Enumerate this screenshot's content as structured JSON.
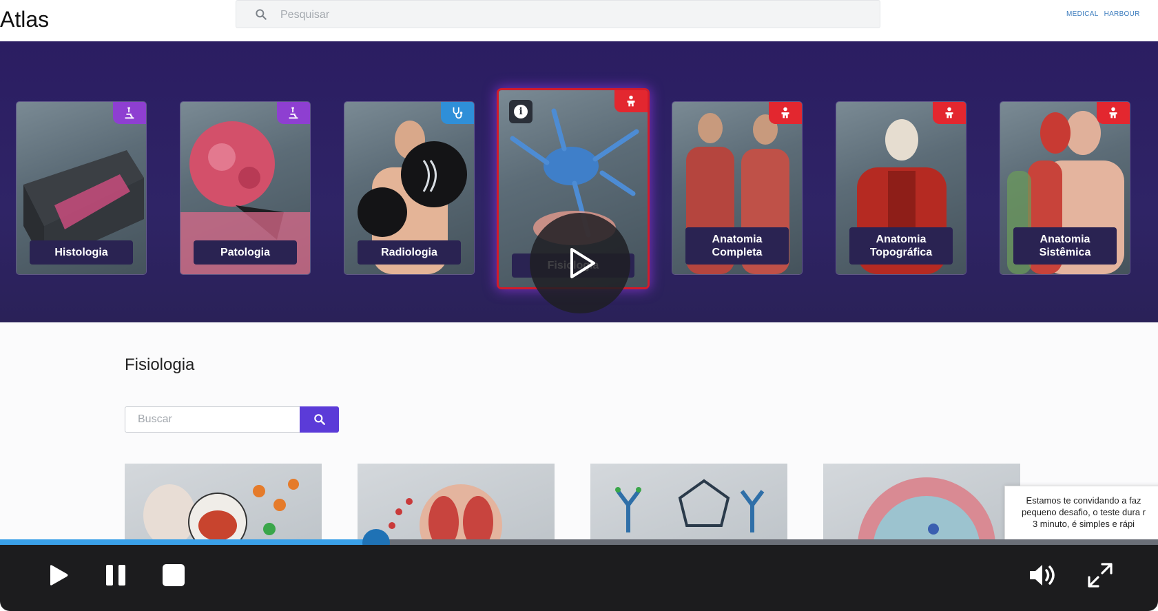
{
  "header": {
    "title": "Atlas",
    "search_placeholder": "Pesquisar",
    "brand_left": "MEDICAL",
    "brand_right": "HARBOUR"
  },
  "categories": [
    {
      "label": "Histologia",
      "badge_icon": "microscope-icon",
      "badge_color": "#8e3fd1"
    },
    {
      "label": "Patologia",
      "badge_icon": "microscope-icon",
      "badge_color": "#8e3fd1"
    },
    {
      "label": "Radiologia",
      "badge_icon": "stethoscope-icon",
      "badge_color": "#2f8fd8"
    },
    {
      "label": "Fisiologia",
      "badge_icon": "body-icon",
      "badge_color": "#e3272f",
      "active": true
    },
    {
      "label": "Anatomia Completa",
      "badge_icon": "body-icon",
      "badge_color": "#e3272f"
    },
    {
      "label": "Anatomia Topográfica",
      "badge_icon": "body-icon",
      "badge_color": "#e3272f"
    },
    {
      "label": "Anatomia Sistêmica",
      "badge_icon": "body-icon",
      "badge_color": "#e3272f"
    }
  ],
  "section": {
    "title": "Fisiologia",
    "search_placeholder": "Buscar"
  },
  "toast": {
    "line1": "Estamos te convidando a faz",
    "line2": "pequeno desafio, o teste dura r",
    "line3": "3 minuto, é simples e rápi"
  },
  "player": {
    "progress_fraction": 0.325,
    "accent": "#3aa0e8"
  }
}
